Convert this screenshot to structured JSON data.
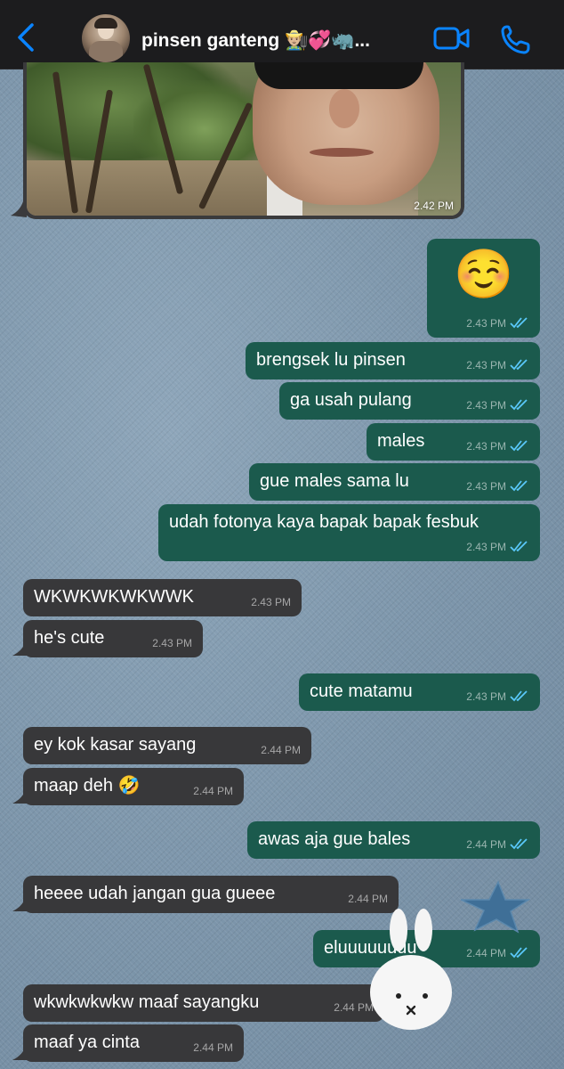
{
  "header": {
    "contact_name": "pinsen ganteng 👨🏼‍🌾💞🦏...",
    "accent_color": "#0a84ff",
    "back_icon": "chevron-left-icon",
    "video_icon": "video-camera-icon",
    "call_icon": "phone-icon"
  },
  "photo_message": {
    "time": "2.42 PM"
  },
  "messages": [
    {
      "dir": "out",
      "text": "☺️",
      "time": "2.43 PM",
      "read": true
    },
    {
      "dir": "out",
      "text": "brengsek lu pinsen",
      "time": "2.43 PM",
      "read": true
    },
    {
      "dir": "out",
      "text": "ga usah pulang",
      "time": "2.43 PM",
      "read": true
    },
    {
      "dir": "out",
      "text": "males",
      "time": "2.43 PM",
      "read": true
    },
    {
      "dir": "out",
      "text": "gue males sama lu",
      "time": "2.43 PM",
      "read": true
    },
    {
      "dir": "out",
      "text": "udah fotonya kaya bapak bapak fesbuk",
      "time": "2.43 PM",
      "read": true
    },
    {
      "dir": "in",
      "text": "WKWKWKWKWWK",
      "time": "2.43 PM"
    },
    {
      "dir": "in",
      "text": "he's cute",
      "time": "2.43 PM"
    },
    {
      "dir": "out",
      "text": "cute matamu",
      "time": "2.43 PM",
      "read": true
    },
    {
      "dir": "in",
      "text": "ey kok kasar sayang",
      "time": "2.44 PM"
    },
    {
      "dir": "in",
      "text": "maap deh 🤣",
      "time": "2.44 PM"
    },
    {
      "dir": "out",
      "text": "awas aja gue bales",
      "time": "2.44 PM",
      "read": true
    },
    {
      "dir": "in",
      "text": "heeee udah jangan gua gueee",
      "time": "2.44 PM"
    },
    {
      "dir": "out",
      "text": "eluuuuuuuu",
      "time": "2.44 PM",
      "read": true
    },
    {
      "dir": "in",
      "text": "wkwkwkwkw maaf sayangku",
      "time": "2.44 PM"
    },
    {
      "dir": "in",
      "text": "maaf ya cinta",
      "time": "2.44 PM"
    }
  ],
  "colors": {
    "outgoing_bubble": "#1b5a4d",
    "incoming_bubble": "#38383a",
    "read_ticks": "#5ac8fa"
  }
}
